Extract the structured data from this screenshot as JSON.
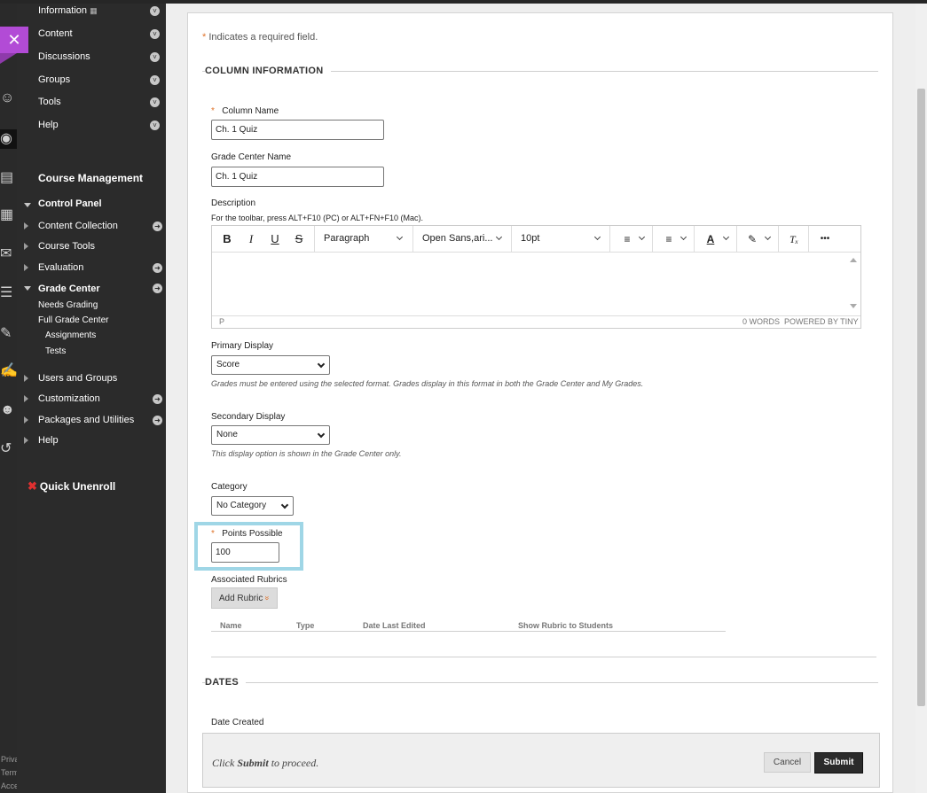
{
  "sidebar": {
    "top_items": [
      {
        "label": "Information"
      },
      {
        "label": "Content"
      },
      {
        "label": "Discussions"
      },
      {
        "label": "Groups"
      },
      {
        "label": "Tools"
      },
      {
        "label": "Help"
      }
    ],
    "course_management": "Course Management",
    "control_panel": "Control Panel",
    "cp_items": {
      "content_collection": "Content Collection",
      "course_tools": "Course Tools",
      "evaluation": "Evaluation",
      "grade_center": "Grade Center",
      "needs_grading": "Needs Grading",
      "full_grade_center": "Full Grade Center",
      "assignments": "Assignments",
      "tests": "Tests",
      "users_and_groups": "Users and Groups",
      "customization": "Customization",
      "packages_and_utilities": "Packages and Utilities",
      "help": "Help"
    },
    "quick_unenroll": "Quick Unenroll",
    "footer_fragments": [
      "Priva",
      "Term",
      "Acce"
    ]
  },
  "form": {
    "required_star": "*",
    "required_note": "Indicates a required field.",
    "section_column_info": "COLUMN INFORMATION",
    "column_name": {
      "label": "Column Name",
      "value": "Ch. 1 Quiz"
    },
    "grade_center_name": {
      "label": "Grade Center Name",
      "value": "Ch. 1 Quiz"
    },
    "description": {
      "label": "Description",
      "toolbar_hint": "For the toolbar, press ALT+F10 (PC) or ALT+FN+F10 (Mac).",
      "toolbar": {
        "bold": "B",
        "italic": "I",
        "underline": "U",
        "strike": "S",
        "block_format": "Paragraph",
        "font_family": "Open Sans,ari...",
        "font_size": "10pt",
        "more": "•••"
      },
      "status_path": "P",
      "status_words": "0 WORDS",
      "status_powered": "POWERED BY TINY"
    },
    "primary_display": {
      "label": "Primary Display",
      "value": "Score",
      "hint": "Grades must be entered using the selected format. Grades display in this format in both the Grade Center and My Grades."
    },
    "secondary_display": {
      "label": "Secondary Display",
      "value": "None",
      "hint": "This display option is shown in the Grade Center only."
    },
    "category": {
      "label": "Category",
      "value": "No Category"
    },
    "points_possible": {
      "label": "Points Possible",
      "value": "100"
    },
    "associated_rubrics": {
      "label": "Associated Rubrics",
      "add_button": "Add Rubric",
      "add_button_glyph": "»",
      "columns": [
        "Name",
        "Type",
        "Date Last Edited",
        "Show Rubric to Students"
      ]
    },
    "section_dates": "DATES",
    "date_created_label": "Date Created"
  },
  "footer": {
    "proceed_prefix": "Click",
    "proceed_bold": "Submit",
    "proceed_suffix": "to proceed.",
    "cancel": "Cancel",
    "submit": "Submit"
  }
}
